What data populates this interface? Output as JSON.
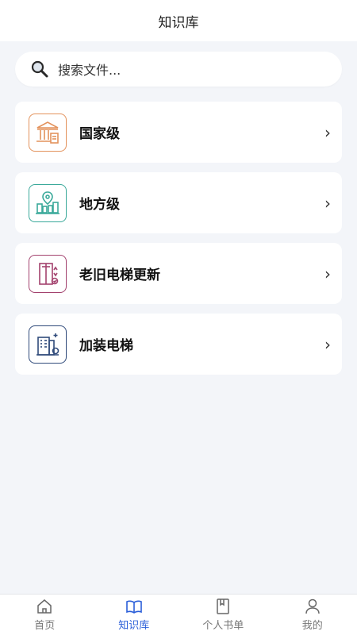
{
  "header": {
    "title": "知识库"
  },
  "search": {
    "placeholder": "搜索文件..."
  },
  "categories": [
    {
      "label": "国家级",
      "icon": "government-building-icon",
      "color": "#e3925c"
    },
    {
      "label": "地方级",
      "icon": "city-location-icon",
      "color": "#3aa99a"
    },
    {
      "label": "老旧电梯更新",
      "icon": "elevator-renewal-icon",
      "color": "#a3426e"
    },
    {
      "label": "加装电梯",
      "icon": "building-elevator-icon",
      "color": "#2f4a7a"
    }
  ],
  "tabbar": {
    "items": [
      {
        "label": "首页",
        "icon": "home-icon",
        "active": false
      },
      {
        "label": "知识库",
        "icon": "book-open-icon",
        "active": true
      },
      {
        "label": "个人书单",
        "icon": "bookmark-book-icon",
        "active": false
      },
      {
        "label": "我的",
        "icon": "user-icon",
        "active": false
      }
    ]
  },
  "colors": {
    "accent": "#2b5fd9",
    "background": "#f3f5f9"
  }
}
